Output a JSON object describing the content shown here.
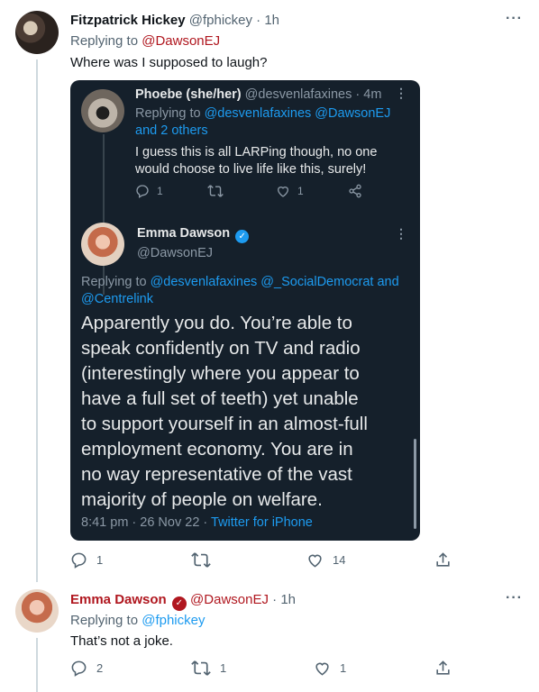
{
  "tweet1": {
    "name": "Fitzpatrick Hickey",
    "handle": "@fphickey",
    "time": "· 1h",
    "replying_prefix": "Replying to ",
    "replying_to": "@DawsonEJ",
    "text": "Where was I supposed to laugh?",
    "embedded": {
      "phoebe": {
        "name": "Phoebe (she/her)",
        "handle": "@desvenlafaxines",
        "time": "· 4m",
        "replying_prefix": "Replying to ",
        "replying_to_1": "@desvenlafaxines @DawsonEJ",
        "replying_to_2": "and 2 others",
        "text_line1": "I guess this is all LARPing though, no one",
        "text_line2": "would choose to live life like this, surely!",
        "replies": "1",
        "likes": "1"
      },
      "emma": {
        "name": "Emma Dawson",
        "handle": "@DawsonEJ",
        "replying_prefix": "Replying to ",
        "replying_to_1": "@desvenlafaxines @_SocialDemocrat and",
        "replying_to_2": "@Centrelink",
        "text": "Apparently you do. You’re able to\nspeak confidently on TV and radio\n(interestingly where you appear to\nhave a full set of teeth) yet unable\nto support yourself in an almost-full\nemployment economy. You are in\nno way representative of the vast\nmajority of people on welfare.",
        "timestamp": "8:41 pm · 26 Nov 22 · ",
        "source": "Twitter for iPhone"
      }
    },
    "replies": "1",
    "retweets": "",
    "likes": "14"
  },
  "tweet2": {
    "name": "Emma Dawson",
    "handle": "@DawsonEJ",
    "time": "· 1h",
    "replying_prefix": "Replying to ",
    "replying_to": "@fphickey",
    "text": "That’s not a joke.",
    "replies": "2",
    "retweets": "1",
    "likes": "1"
  },
  "icons": {
    "reply": "reply-icon",
    "retweet": "retweet-icon",
    "like": "heart-icon",
    "share": "share-icon",
    "more": "more-icon",
    "verified": "verified-badge-icon"
  },
  "colors": {
    "accent_blue": "#1d9bf0",
    "accent_red": "#b0171f",
    "dark_bg": "#15202b"
  }
}
